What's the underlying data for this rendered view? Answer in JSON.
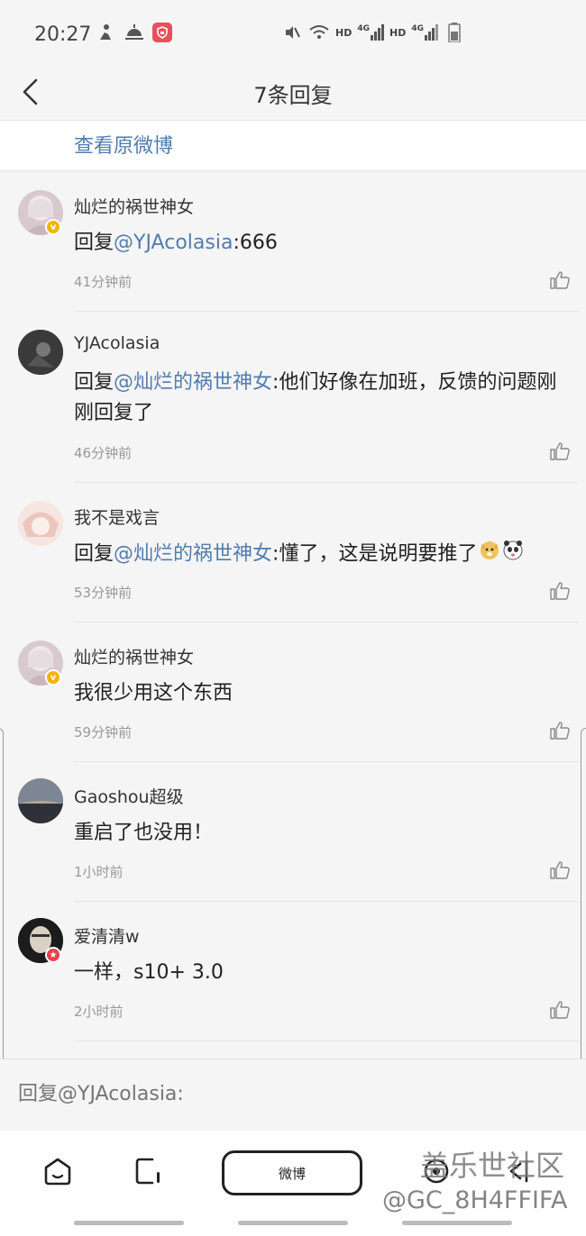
{
  "status_bar": {
    "time": "20:27",
    "net1": "HD",
    "net1_gen": "4G",
    "net2": "HD",
    "net2_gen": "4G"
  },
  "header": {
    "title": "7条回复",
    "back_icon": "chevron-left-icon"
  },
  "original_link": "查看原微博",
  "comments": [
    {
      "name": "灿烂的祸世神女",
      "prefix": "回复",
      "mention": "@YJAcolasia",
      "text": ":666",
      "time": "41分钟前",
      "avatar_color": "#d8c9cf",
      "badge": "v-yellow"
    },
    {
      "name": "YJAcolasia",
      "prefix": "回复",
      "mention": "@灿烂的祸世神女",
      "text": ":他们好像在加班，反馈的问题刚刚回复了",
      "time": "46分钟前",
      "avatar_color": "#2b2b2b"
    },
    {
      "name": "我不是戏言",
      "prefix": "回复",
      "mention": "@灿烂的祸世神女",
      "text": ":懂了，这是说明要推了",
      "time": "53分钟前",
      "avatar_color": "#f0d8d2",
      "emoji": [
        "doge-emoji",
        "panda-emoji"
      ]
    },
    {
      "name": "灿烂的祸世神女",
      "prefix": "",
      "mention": "",
      "text": "我很少用这个东西",
      "time": "59分钟前",
      "avatar_color": "#d8c9cf",
      "badge": "v-yellow"
    },
    {
      "name": "Gaoshou超级",
      "prefix": "",
      "mention": "",
      "text": "重启了也没用！",
      "time": "1小时前",
      "avatar_color": "#59606a"
    },
    {
      "name": "爱清清w",
      "prefix": "",
      "mention": "",
      "text": "一样，s10+ 3.0",
      "time": "2小时前",
      "avatar_color": "#1c1c1c",
      "badge": "red"
    }
  ],
  "reply_bar": {
    "placeholder": "回复@YJAcolasia:"
  },
  "navbar": {
    "weibo_label": "微博",
    "watermark_main": "盖乐世社区",
    "watermark_sub": "@GC_8H4FFIFA"
  },
  "colors": {
    "link": "#507daf",
    "background": "#f5f5f5",
    "badge_yellow": "#f2b30a",
    "badge_red": "#e8404a"
  }
}
